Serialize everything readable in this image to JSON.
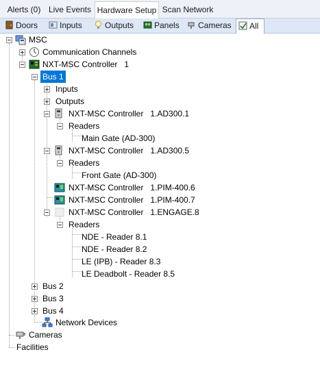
{
  "tabs_top": [
    {
      "label": "Alerts (0)",
      "active": false
    },
    {
      "label": "Live Events",
      "active": false
    },
    {
      "label": "Hardware Setup",
      "active": true
    },
    {
      "label": "Scan Network",
      "active": false
    }
  ],
  "tabs_sub": [
    {
      "label": "Doors",
      "icon": "door-icon",
      "active": false
    },
    {
      "label": "Inputs",
      "icon": "input-icon",
      "active": false
    },
    {
      "label": "Outputs",
      "icon": "bulb-icon",
      "active": false
    },
    {
      "label": "Panels",
      "icon": "panel-icon",
      "active": false
    },
    {
      "label": "Cameras",
      "icon": "camera-icon",
      "active": false
    },
    {
      "label": "All",
      "icon": "all-icon",
      "active": true
    }
  ],
  "tree": {
    "root": "MSC",
    "comm_channels": "Communication Channels",
    "controller": "NXT-MSC Controller   1",
    "bus1": "Bus 1",
    "inputs": "Inputs",
    "outputs": "Outputs",
    "ad300_1": "NXT-MSC Controller   1.AD300.1",
    "readers1": "Readers",
    "main_gate": "Main Gate (AD-300)",
    "ad300_5": "NXT-MSC Controller   1.AD300.5",
    "readers2": "Readers",
    "front_gate": "Front Gate (AD-300)",
    "pim_6": "NXT-MSC Controller   1.PIM-400.6",
    "pim_7": "NXT-MSC Controller   1.PIM-400.7",
    "engage_8": "NXT-MSC Controller   1.ENGAGE.8",
    "readers3": "Readers",
    "nde_81": "NDE - Reader 8.1",
    "nde_82": "NDE - Reader 8.2",
    "le_83": "LE (IPB) - Reader 8.3",
    "le_85": "LE Deadbolt - Reader 8.5",
    "bus2": "Bus 2",
    "bus3": "Bus 3",
    "bus4": "Bus 4",
    "network_devices": "Network Devices",
    "cameras": "Cameras",
    "facilities": "Facilities"
  },
  "colors": {
    "selection": "#0078d7",
    "tab_bar": "#eef1f7",
    "sub_tab_bar": "#dde7f6"
  }
}
